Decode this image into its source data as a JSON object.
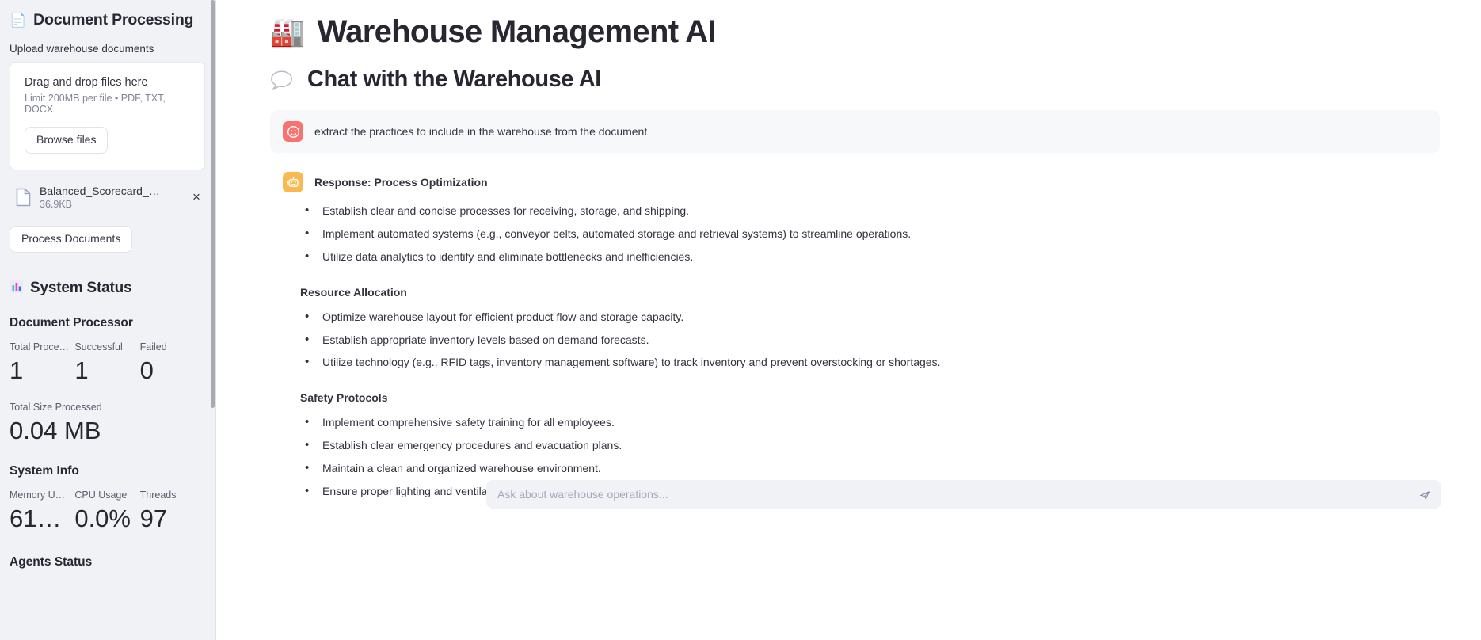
{
  "sidebar": {
    "panel_title": "Document Processing",
    "panel_icon": "document-icon",
    "upload_caption": "Upload warehouse documents",
    "dropzone": {
      "title": "Drag and drop files here",
      "limits": "Limit 200MB per file • PDF, TXT, DOCX",
      "browse_label": "Browse files"
    },
    "uploaded_file": {
      "name": "Balanced_Scorecard_Pr…",
      "size": "36.9KB",
      "remove_label": "×",
      "icon": "file-icon"
    },
    "process_label": "Process Documents",
    "system_status": {
      "title": "System Status",
      "icon": "bar-chart-icon",
      "document_processor": {
        "title": "Document Processor",
        "metrics": [
          {
            "label": "Total Proce…",
            "value": "1"
          },
          {
            "label": "Successful",
            "value": "1"
          },
          {
            "label": "Failed",
            "value": "0"
          }
        ],
        "total_size": {
          "label": "Total Size Processed",
          "value": "0.04 MB"
        }
      },
      "system_info": {
        "title": "System Info",
        "metrics": [
          {
            "label": "Memory Us…",
            "value": "61…"
          },
          {
            "label": "CPU Usage",
            "value": "0.0%"
          },
          {
            "label": "Threads",
            "value": "97"
          }
        ]
      },
      "agents_status_title": "Agents Status"
    }
  },
  "main": {
    "app_title": "Warehouse Management AI",
    "app_emoji": "🏭",
    "chat_title": "Chat with the Warehouse AI",
    "chat_icon": "speech-bubble-icon",
    "messages": [
      {
        "role": "user",
        "avatar_icon": "user-face-icon",
        "avatar_color": "#f8736f",
        "text": "extract the practices to include in the warehouse from the document"
      },
      {
        "role": "assistant",
        "avatar_icon": "robot-icon",
        "avatar_color": "#f9b94e",
        "header": "Response: Process Optimization",
        "sections": [
          {
            "heading": "",
            "bullets": [
              "Establish clear and concise processes for receiving, storage, and shipping.",
              "Implement automated systems (e.g., conveyor belts, automated storage and retrieval systems) to streamline operations.",
              "Utilize data analytics to identify and eliminate bottlenecks and inefficiencies."
            ]
          },
          {
            "heading": "Resource Allocation",
            "bullets": [
              "Optimize warehouse layout for efficient product flow and storage capacity.",
              "Establish appropriate inventory levels based on demand forecasts.",
              "Utilize technology (e.g., RFID tags, inventory management software) to track inventory and prevent overstocking or shortages."
            ]
          },
          {
            "heading": "Safety Protocols",
            "bullets": [
              "Implement comprehensive safety training for all employees.",
              "Establish clear emergency procedures and evacuation plans.",
              "Maintain a clean and organized warehouse environment.",
              "Ensure proper lighting and ventilation"
            ]
          }
        ]
      }
    ],
    "composer": {
      "placeholder": "Ask about warehouse operations...",
      "value": "",
      "send_icon": "send-icon",
      "send_color": "#6b7ba0"
    }
  },
  "colors": {
    "sidebar_bg": "#f0f2f6",
    "text": "#262730",
    "muted": "#808495",
    "accent": "#ff4b4b",
    "user_avatar": "#f8736f",
    "assistant_avatar": "#f9b94e"
  }
}
